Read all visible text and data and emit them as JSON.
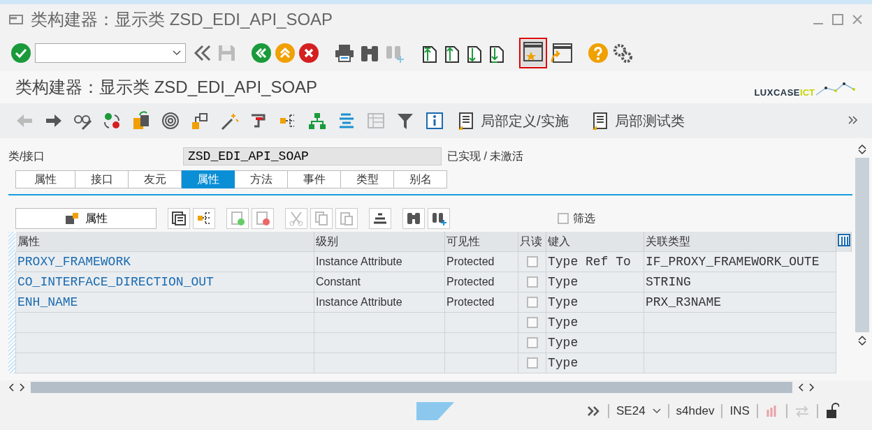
{
  "window": {
    "title": "类构建器：显示类 ZSD_EDI_API_SOAP"
  },
  "header": {
    "title": "类构建器：显示类 ZSD_EDI_API_SOAP",
    "logo": {
      "text": "LUXCASE",
      "accent": "ICT"
    }
  },
  "app_toolbar": {
    "buttons": [
      {
        "label": "局部定义/实施"
      },
      {
        "label": "局部测试类"
      }
    ]
  },
  "class_field": {
    "label": "类/接口",
    "value": "ZSD_EDI_API_SOAP",
    "status": "已实现 / 未激活"
  },
  "tabs": [
    {
      "label": "属性",
      "selected": false
    },
    {
      "label": "接口",
      "selected": false
    },
    {
      "label": "友元",
      "selected": false
    },
    {
      "label": "属性",
      "selected": true
    },
    {
      "label": "方法",
      "selected": false
    },
    {
      "label": "事件",
      "selected": false
    },
    {
      "label": "类型",
      "selected": false
    },
    {
      "label": "别名",
      "selected": false
    }
  ],
  "table_toolbar": {
    "button": "属性",
    "filter": {
      "label": "筛选",
      "checked": false
    }
  },
  "table": {
    "columns": [
      "属性",
      "级别",
      "可见性",
      "只读",
      "键入",
      "关联类型"
    ],
    "rows": [
      {
        "attribute": "PROXY_FRAMEWORK",
        "level": "Instance Attribute",
        "visibility": "Protected",
        "read_only": false,
        "typing": "Type Ref To",
        "associated_type": "IF_PROXY_FRAMEWORK_OUTE"
      },
      {
        "attribute": "CO_INTERFACE_DIRECTION_OUT",
        "level": "Constant",
        "visibility": "Protected",
        "read_only": false,
        "typing": "Type",
        "associated_type": "STRING"
      },
      {
        "attribute": "ENH_NAME",
        "level": "Instance Attribute",
        "visibility": "Protected",
        "read_only": false,
        "typing": "Type",
        "associated_type": "PRX_R3NAME"
      },
      {
        "read_only": false,
        "typing": "Type"
      },
      {
        "read_only": false,
        "typing": "Type"
      },
      {
        "read_only": false,
        "typing": "Type"
      }
    ]
  },
  "status_bar": {
    "transaction": "SE24",
    "system": "s4hdev",
    "mode": "INS"
  }
}
